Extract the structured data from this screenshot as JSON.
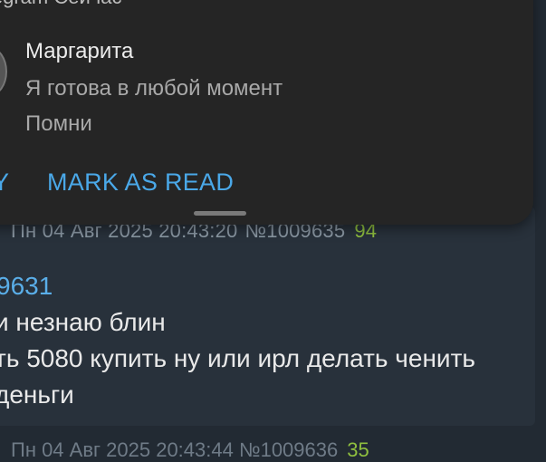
{
  "notification": {
    "header": "legram  Сейчас",
    "sender": "Маргарита",
    "line1": "Я готова в любой момент",
    "line2": "Помни",
    "action_edge": "Y",
    "mark_as_read": "MARK AS READ"
  },
  "message": {
    "date": "Пн 04 Авг 2025 20:43:20",
    "number": "№1009635",
    "score": "94",
    "reply_ref": "9631",
    "lines": [
      "и незнаю блин",
      "ть 5080 купить ну или ирл делать ченить",
      "деньги"
    ]
  },
  "next_message": {
    "date": "Пн 04 Авг 2025 20:43:44",
    "number": "№1009636",
    "score": "35"
  }
}
